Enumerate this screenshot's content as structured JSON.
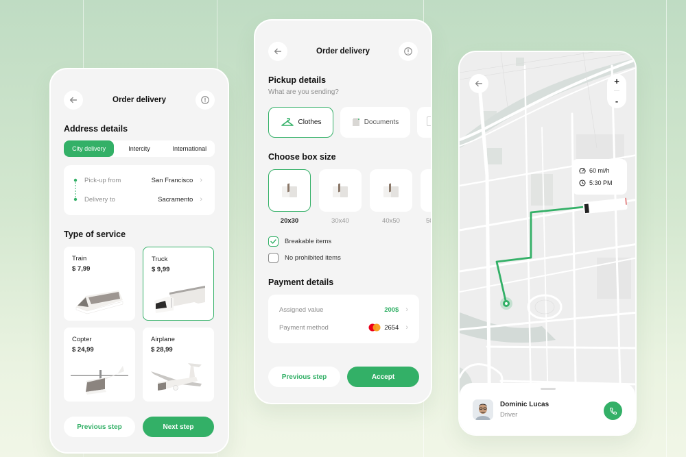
{
  "colors": {
    "accent": "#33b067",
    "route": "#33b067",
    "panel": "#f4f4f4"
  },
  "screen1": {
    "header": {
      "title": "Order delivery",
      "back_icon": "arrow-left-icon",
      "info_icon": "info-circle-icon"
    },
    "address": {
      "title": "Address details",
      "tabs": [
        {
          "label": "City delivery",
          "active": true
        },
        {
          "label": "Intercity",
          "active": false
        },
        {
          "label": "International",
          "active": false
        }
      ],
      "rows": [
        {
          "label": "Pick-up from",
          "value": "San Francisco"
        },
        {
          "label": "Delivery to",
          "value": "Sacramento"
        }
      ]
    },
    "service": {
      "title": "Type of service",
      "options": [
        {
          "name": "Train",
          "price": "$ 7,99",
          "selected": false
        },
        {
          "name": "Truck",
          "price": "$ 9,99",
          "selected": true
        },
        {
          "name": "Copter",
          "price": "$ 24,99",
          "selected": false
        },
        {
          "name": "Airplane",
          "price": "$ 28,99",
          "selected": false
        }
      ]
    },
    "buttons": {
      "previous": "Previous step",
      "next": "Next step"
    }
  },
  "screen2": {
    "header": {
      "title": "Order delivery",
      "back_icon": "arrow-left-icon",
      "info_icon": "info-circle-icon"
    },
    "pickup": {
      "title": "Pickup details",
      "subtitle": "What are you sending?",
      "categories": [
        {
          "label": "Clothes",
          "icon": "hanger-icon",
          "selected": true
        },
        {
          "label": "Documents",
          "icon": "document-icon",
          "selected": false
        }
      ]
    },
    "box": {
      "title": "Choose box size",
      "sizes": [
        {
          "label": "20x30",
          "selected": true
        },
        {
          "label": "30x40",
          "selected": false
        },
        {
          "label": "40x50",
          "selected": false
        },
        {
          "label": "50",
          "selected": false
        }
      ],
      "checks": [
        {
          "label": "Breakable items",
          "checked": true
        },
        {
          "label": "No prohibited items",
          "checked": false
        }
      ]
    },
    "payment": {
      "title": "Payment details",
      "rows": [
        {
          "label": "Assigned value",
          "value": "200$"
        },
        {
          "label": "Payment method",
          "value": "2654",
          "icon": "mastercard-icon"
        }
      ]
    },
    "buttons": {
      "previous": "Previous step",
      "accept": "Accept"
    }
  },
  "screen3": {
    "zoom": {
      "in": "+",
      "out": "-"
    },
    "info": {
      "speed": "60 mi/h",
      "eta": "5:30 PM"
    },
    "driver": {
      "name": "Dominic Lucas",
      "role": "Driver"
    }
  }
}
